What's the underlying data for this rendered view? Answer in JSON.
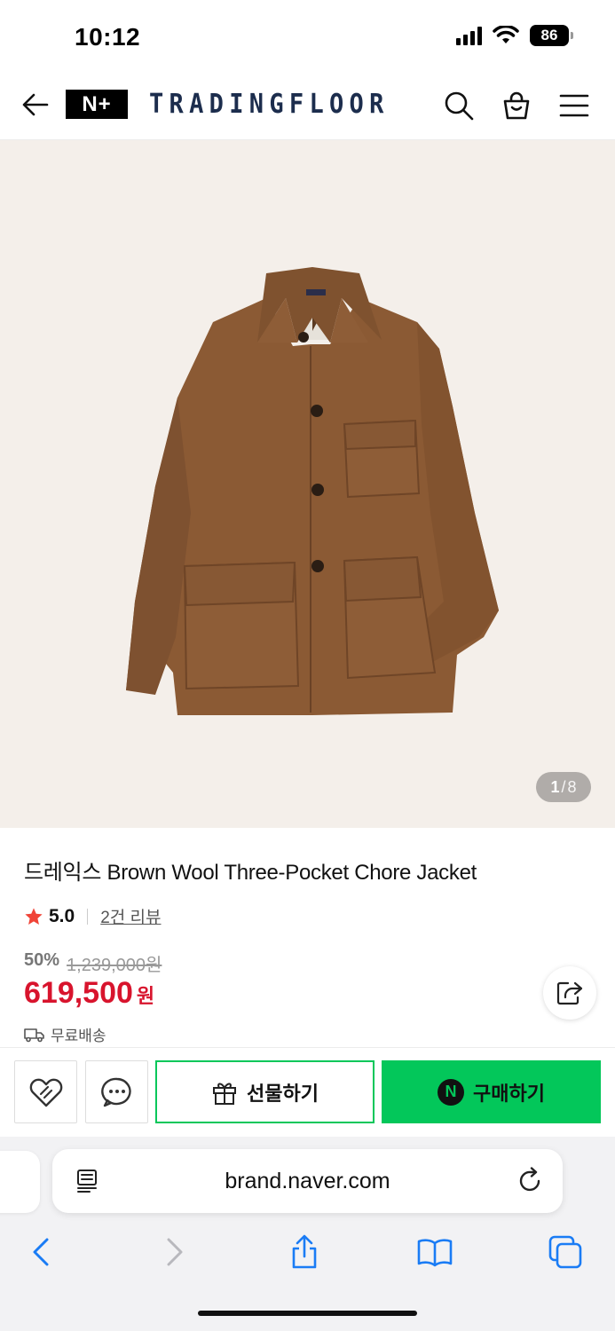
{
  "status": {
    "time": "10:12",
    "battery": "86"
  },
  "header": {
    "logo": "N+",
    "brand": "TRADINGFLOOR"
  },
  "image": {
    "current": "1",
    "total": "8",
    "separator": "/"
  },
  "product": {
    "title": "드레익스 Brown Wool Three-Pocket Chore Jacket",
    "rating": "5.0",
    "reviews": "2건 리뷰",
    "discount": "50%",
    "original_price": "1,239,000원",
    "sale_price": "619,500",
    "currency": "원",
    "delivery": "무료배송"
  },
  "actions": {
    "gift_label": "선물하기",
    "buy_label": "구매하기",
    "buy_badge": "N"
  },
  "browser": {
    "url": "brand.naver.com"
  },
  "colors": {
    "naver_green": "#03c75a",
    "price_red": "#d8142d",
    "brand_navy": "#1c2d4d",
    "safari_blue": "#1a7cf5"
  },
  "icons": [
    "back-arrow-icon",
    "search-icon",
    "cart-icon",
    "menu-icon",
    "star-icon",
    "delivery-truck-icon",
    "share-icon",
    "wishlist-heart-icon",
    "chat-icon",
    "gift-icon",
    "reader-icon",
    "reload-icon",
    "safari-back-icon",
    "safari-forward-icon",
    "safari-share-icon",
    "bookmarks-icon",
    "tabs-icon"
  ]
}
